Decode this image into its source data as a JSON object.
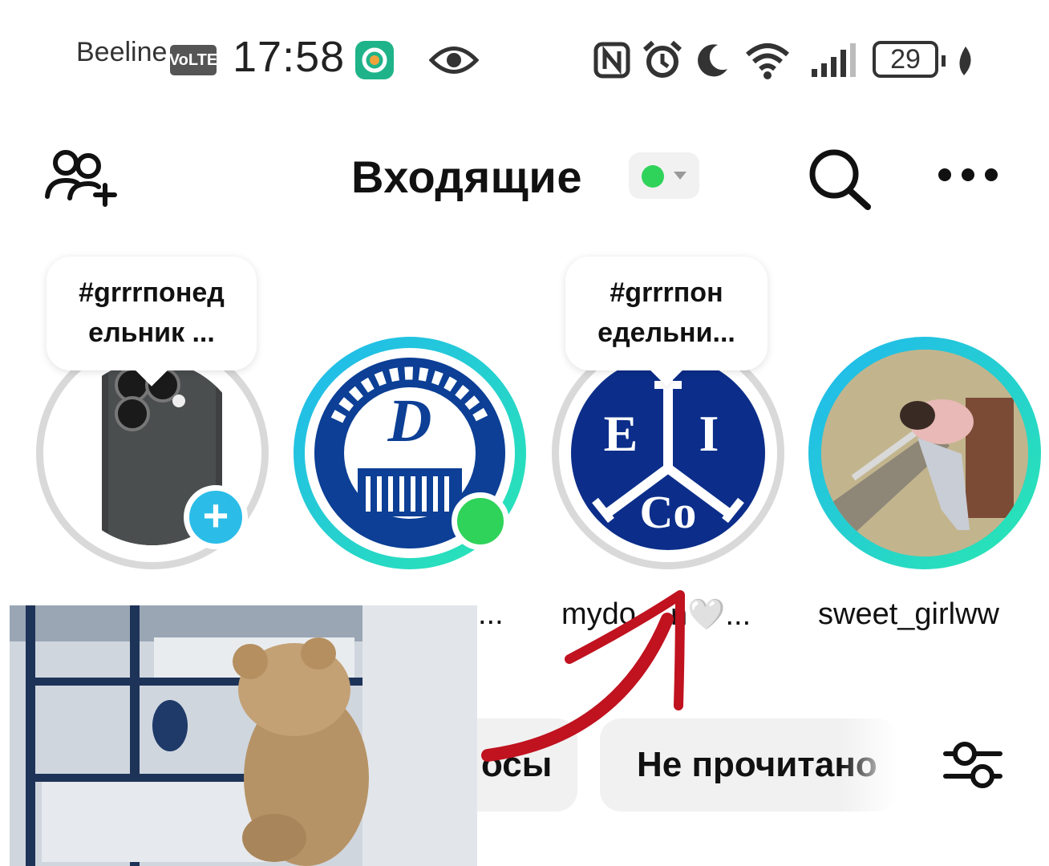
{
  "status_bar": {
    "carrier": "Beeline",
    "network_badge": "VoLTE",
    "time": "17:58",
    "battery": "29",
    "icons": [
      "app-icon",
      "eye-icon",
      "nfc-icon",
      "alarm-icon",
      "moon-icon",
      "wifi-icon",
      "signal-icon",
      "battery-icon",
      "leaf-icon"
    ]
  },
  "header": {
    "title": "Входящие",
    "status_color": "#2fd35a",
    "left_icon": "add-friends-icon",
    "search_icon": "search-icon",
    "more_icon": "more-icon"
  },
  "stories": [
    {
      "name": "",
      "note": "#grrrпонедельник ...",
      "ring": "grey",
      "badge": "add"
    },
    {
      "name": "...",
      "note": "",
      "ring": "gradient",
      "badge": "online"
    },
    {
      "name": "mydo…n🤍...",
      "note": "#grrrпонедельни...",
      "ring": "grey",
      "badge": ""
    },
    {
      "name": "sweet_girlww",
      "note": "",
      "ring": "gradient",
      "badge": ""
    }
  ],
  "stories_text": {
    "note_1_line_1": "#grrrпонед",
    "note_1_line_2": "ельник ...",
    "note_3_line_1": "#grrrпон",
    "note_3_line_2": "едельни...",
    "name_2": "...",
    "name_3": "mydo",
    "name_3_tail": "n🤍...",
    "name_4": "sweet_girlww",
    "add_label": "+"
  },
  "filters": {
    "chip_1": "осы",
    "chip_2": "Не прочитано",
    "filter_icon": "filter-settings-icon"
  },
  "colors": {
    "accent_blue": "#2bbde8",
    "ring_gradient_start": "#20b7f0",
    "ring_gradient_end": "#2ae8b0",
    "online_green": "#2fd35a",
    "arrow_red": "#c0121f"
  }
}
